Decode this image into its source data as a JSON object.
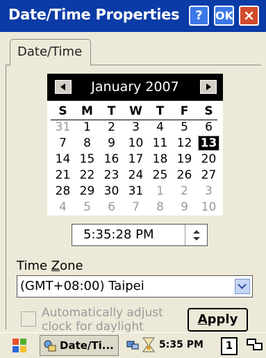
{
  "window": {
    "title": "Date/Time Properties",
    "help_label": "?",
    "ok_label": "OK",
    "close_label": "×"
  },
  "tabs": [
    {
      "label": "Date/Time",
      "selected": true
    }
  ],
  "calendar": {
    "month_year": "January 2007",
    "weekdays": [
      "S",
      "M",
      "T",
      "W",
      "T",
      "F",
      "S"
    ],
    "days": [
      {
        "n": "31",
        "other": true
      },
      {
        "n": "1"
      },
      {
        "n": "2"
      },
      {
        "n": "3"
      },
      {
        "n": "4"
      },
      {
        "n": "5"
      },
      {
        "n": "6"
      },
      {
        "n": "7"
      },
      {
        "n": "8"
      },
      {
        "n": "9"
      },
      {
        "n": "10"
      },
      {
        "n": "11"
      },
      {
        "n": "12"
      },
      {
        "n": "13",
        "selected": true
      },
      {
        "n": "14"
      },
      {
        "n": "15"
      },
      {
        "n": "16"
      },
      {
        "n": "17"
      },
      {
        "n": "18"
      },
      {
        "n": "19"
      },
      {
        "n": "20"
      },
      {
        "n": "21"
      },
      {
        "n": "22"
      },
      {
        "n": "23"
      },
      {
        "n": "24"
      },
      {
        "n": "25"
      },
      {
        "n": "26"
      },
      {
        "n": "27"
      },
      {
        "n": "28"
      },
      {
        "n": "29"
      },
      {
        "n": "30"
      },
      {
        "n": "31"
      },
      {
        "n": "1",
        "other": true
      },
      {
        "n": "2",
        "other": true
      },
      {
        "n": "3",
        "other": true
      },
      {
        "n": "4",
        "other": true
      },
      {
        "n": "5",
        "other": true
      },
      {
        "n": "6",
        "other": true
      },
      {
        "n": "7",
        "other": true
      },
      {
        "n": "8",
        "other": true
      },
      {
        "n": "9",
        "other": true
      },
      {
        "n": "10",
        "other": true
      }
    ]
  },
  "time": {
    "value": "5:35:28 PM"
  },
  "timezone": {
    "label_before": "Time ",
    "label_accel": "Z",
    "label_after": "one",
    "selected": "(GMT+08:00) Taipei"
  },
  "auto_dst": {
    "checked": false,
    "label": "Automatically adjust clock for daylight saving"
  },
  "apply_button": {
    "accel": "A",
    "rest": "pply"
  },
  "taskbar": {
    "task_label": "Date/Ti...",
    "clock": "5:35 PM",
    "input_indicator": "1"
  },
  "colors": {
    "titlebar": "#0a3ba6",
    "dialog_bg": "#ece9d8",
    "close_button": "#d24a2c",
    "calendar_header": "#000000"
  },
  "icons": [
    "help-icon",
    "ok-icon",
    "close-icon",
    "prev-month-icon",
    "next-month-icon",
    "spin-up-icon",
    "spin-down-icon",
    "dropdown-arrow-icon",
    "start-flag-icon",
    "datetime-task-icon",
    "network-icon",
    "clock-tray-icon",
    "keyboard-icon"
  ]
}
